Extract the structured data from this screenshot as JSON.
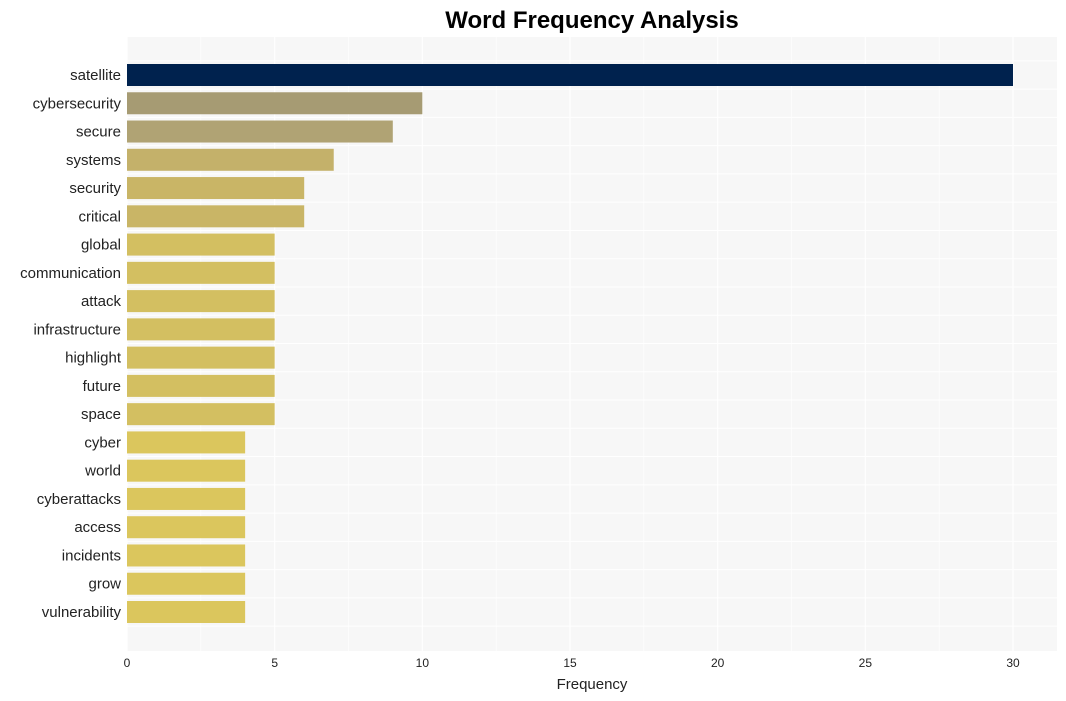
{
  "chart_data": {
    "type": "bar",
    "orientation": "horizontal",
    "title": "Word Frequency Analysis",
    "xlabel": "Frequency",
    "ylabel": "",
    "xlim": [
      0,
      31.5
    ],
    "xticks": [
      0,
      5,
      10,
      15,
      20,
      25,
      30
    ],
    "grid": true,
    "categories": [
      "satellite",
      "cybersecurity",
      "secure",
      "systems",
      "security",
      "critical",
      "global",
      "communication",
      "attack",
      "infrastructure",
      "highlight",
      "future",
      "space",
      "cyber",
      "world",
      "cyberattacks",
      "access",
      "incidents",
      "grow",
      "vulnerability"
    ],
    "values": [
      30,
      10,
      9,
      7,
      6,
      6,
      5,
      5,
      5,
      5,
      5,
      5,
      5,
      4,
      4,
      4,
      4,
      4,
      4,
      4
    ],
    "colors": [
      "#00224e",
      "#a69b73",
      "#b0a374",
      "#c4b16a",
      "#c9b566",
      "#c9b566",
      "#d3bf61",
      "#d3bf61",
      "#d3bf61",
      "#d3bf61",
      "#d3bf61",
      "#d3bf61",
      "#d3bf61",
      "#dbc65d",
      "#dbc65d",
      "#dbc65d",
      "#dbc65d",
      "#dbc65d",
      "#dbc65d",
      "#dbc65d"
    ]
  }
}
